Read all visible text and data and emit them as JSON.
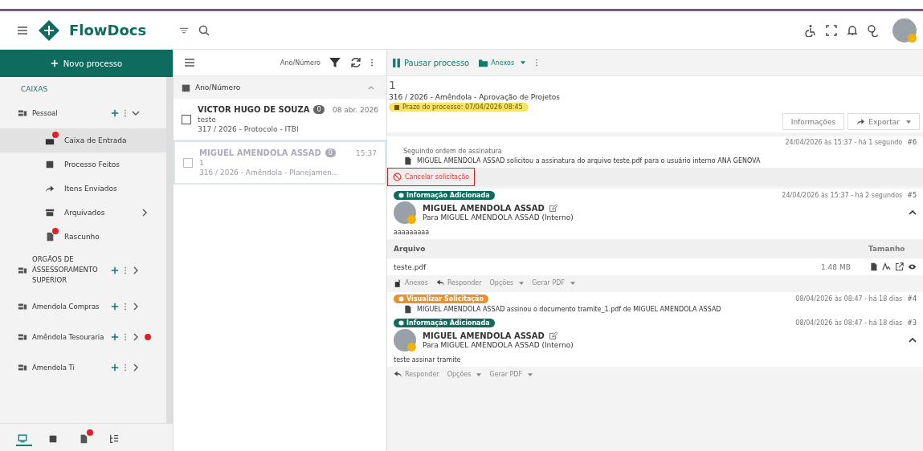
{
  "header": {
    "brand": "FlowDocs"
  },
  "sidebar": {
    "new_button": "Novo processo",
    "section": "CAIXAS",
    "groups": [
      {
        "label": "Pessoal",
        "expanded": true,
        "alert": false,
        "children": [
          {
            "label": "Caixa de Entrada",
            "selected": true,
            "alert": true,
            "expandable": false
          },
          {
            "label": "Processo Feitos",
            "selected": false,
            "alert": false,
            "expandable": false
          },
          {
            "label": "Itens Enviados",
            "selected": false,
            "alert": false,
            "expandable": false
          },
          {
            "label": "Arquivados",
            "selected": false,
            "alert": false,
            "expandable": true
          },
          {
            "label": "Rascunho",
            "selected": false,
            "alert": true,
            "expandable": false
          }
        ]
      },
      {
        "label": "ORGÃOS DE ASSESSORAMENTO SUPERIOR",
        "expanded": false,
        "alert": false
      },
      {
        "label": "Amendola Compras",
        "expanded": false,
        "alert": false
      },
      {
        "label": "Amêndola Tesouraria",
        "expanded": false,
        "alert": true
      },
      {
        "label": "Amendola Ti",
        "expanded": false,
        "alert": false
      }
    ],
    "bottom_tabs": [
      {
        "selected": true,
        "alert": false
      },
      {
        "selected": false,
        "alert": false
      },
      {
        "selected": false,
        "alert": true
      },
      {
        "selected": false,
        "alert": false
      }
    ]
  },
  "list": {
    "sort_label": "Ano/Número",
    "group": {
      "label": "Ano/Número",
      "expanded": true
    },
    "items": [
      {
        "sender": "VICTOR HUGO DE SOUZA",
        "count": "0",
        "date": "08 abr. 2026",
        "subject": "teste",
        "title": "317 / 2026 - Protocolo - ITBI",
        "checked": false,
        "dimmed": false
      },
      {
        "sender": "MIGUEL AMENDOLA ASSAD",
        "count": "0",
        "date": "15:37",
        "subject": "1",
        "title": "316 / 2026 - Amêndola - Planejamen...",
        "checked": false,
        "dimmed": true
      }
    ]
  },
  "main": {
    "pause_button": "Pausar processo",
    "attachments_button": "Anexos",
    "number": "1",
    "title": "316 / 2026 - Amêndola - Aprovação de Projetos",
    "deadline": "Prazo do processo: 07/04/2026 08:45",
    "info_button": "Informações",
    "export_button": "Exportar",
    "events": [
      {
        "kind": "request",
        "heading": "Seguindo ordem de assinatura",
        "text": "MIGUEL AMENDOLA ASSAD solicitou a assinatura do arquivo teste.pdf para o usuário interno ANA GENOVA",
        "timestamp": "24/04/2026 às 15:37 - há 1 segundo",
        "number": "#6",
        "action": "Cancelar solicitação"
      },
      {
        "kind": "message",
        "tag": "Informação Adicionada",
        "color": "#0f6b5e",
        "timestamp": "24/04/2026 às 15:37 - há 2 segundos",
        "number": "#5",
        "author": "MIGUEL AMENDOLA ASSAD",
        "recipient": "Para MIGUEL AMENDOLA ASSAD (Interno)",
        "expanded": true,
        "body": "aaaaaaaaa",
        "files": {
          "columns": [
            "Arquivo",
            "Tamanho"
          ],
          "rows": [
            {
              "name": "teste.pdf",
              "size": "1.48 MB"
            }
          ]
        },
        "actions": [
          {
            "label": "Anexos",
            "kind": "attachments",
            "dropdown": false
          },
          {
            "label": "Responder",
            "kind": "reply",
            "dropdown": false
          },
          {
            "label": "Opções",
            "kind": "menu",
            "dropdown": true
          },
          {
            "label": "Gerar PDF",
            "kind": "menu",
            "dropdown": true
          }
        ]
      },
      {
        "kind": "signed",
        "tag": "Visualizar Solicitação",
        "color": "#e8912d",
        "timestamp": "08/04/2026 às 08:47 - há 18 dias",
        "number": "#4",
        "text": "MIGUEL AMENDOLA ASSAD assinou o documento tramite_1.pdf de MIGUEL AMENDOLA ASSAD"
      },
      {
        "kind": "message",
        "tag": "Informação Adicionada",
        "color": "#0f6b5e",
        "timestamp": "08/04/2026 às 08:47 - há 18 dias",
        "number": "#3",
        "author": "MIGUEL AMENDOLA ASSAD",
        "recipient": "Para MIGUEL AMENDOLA ASSAD (Interno)",
        "expanded": true,
        "body": "teste assinar tramite",
        "actions": [
          {
            "label": "Responder",
            "kind": "reply",
            "dropdown": false
          },
          {
            "label": "Opções",
            "kind": "menu",
            "dropdown": true
          },
          {
            "label": "Gerar PDF",
            "kind": "menu",
            "dropdown": true
          }
        ]
      }
    ]
  }
}
